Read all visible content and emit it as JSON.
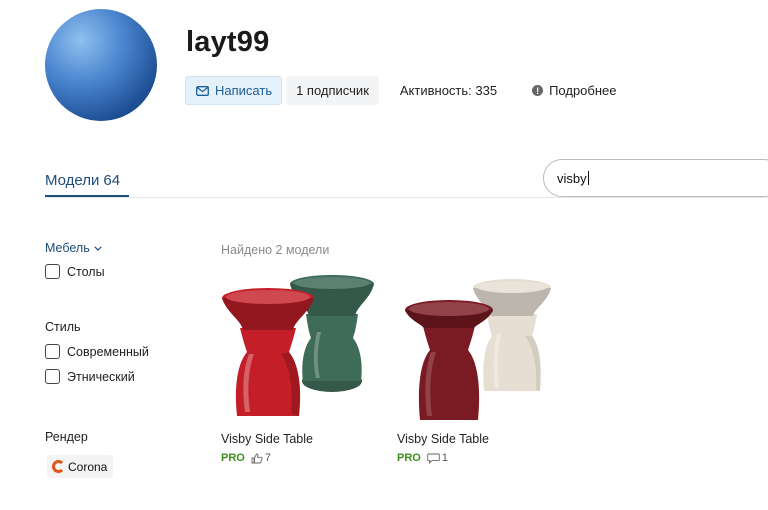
{
  "profile": {
    "username": "layt99",
    "write_label": "Написать",
    "subscribers_label": "1 подписчик",
    "activity_label": "Активность: 335",
    "more_label": "Подробнее"
  },
  "tabs": {
    "models_label": "Модели",
    "models_count": "64"
  },
  "search": {
    "value": "visby"
  },
  "filters": {
    "furniture": {
      "label": "Мебель",
      "options": [
        "Столы"
      ]
    },
    "style": {
      "label": "Стиль",
      "options": [
        "Современный",
        "Этнический"
      ]
    },
    "render": {
      "label": "Рендер",
      "chip": "Corona"
    }
  },
  "results": {
    "found_label": "Найдено 2 модели",
    "items": [
      {
        "title": "Visby Side Table",
        "badge": "PRO",
        "stat_icon": "thumbs-up-icon",
        "stat_value": "7",
        "colors": {
          "front": "#c41f28",
          "back": "#3f6b59"
        }
      },
      {
        "title": "Visby Side Table",
        "badge": "PRO",
        "stat_icon": "comment-icon",
        "stat_value": "1",
        "colors": {
          "front": "#7a1a22",
          "back": "#e6ded2"
        }
      }
    ]
  },
  "colors": {
    "accent": "#1d4d7a",
    "write_button_bg": "#e4f0fa",
    "pro_green": "#3f8f1f",
    "corona_orange": "#e25518"
  }
}
